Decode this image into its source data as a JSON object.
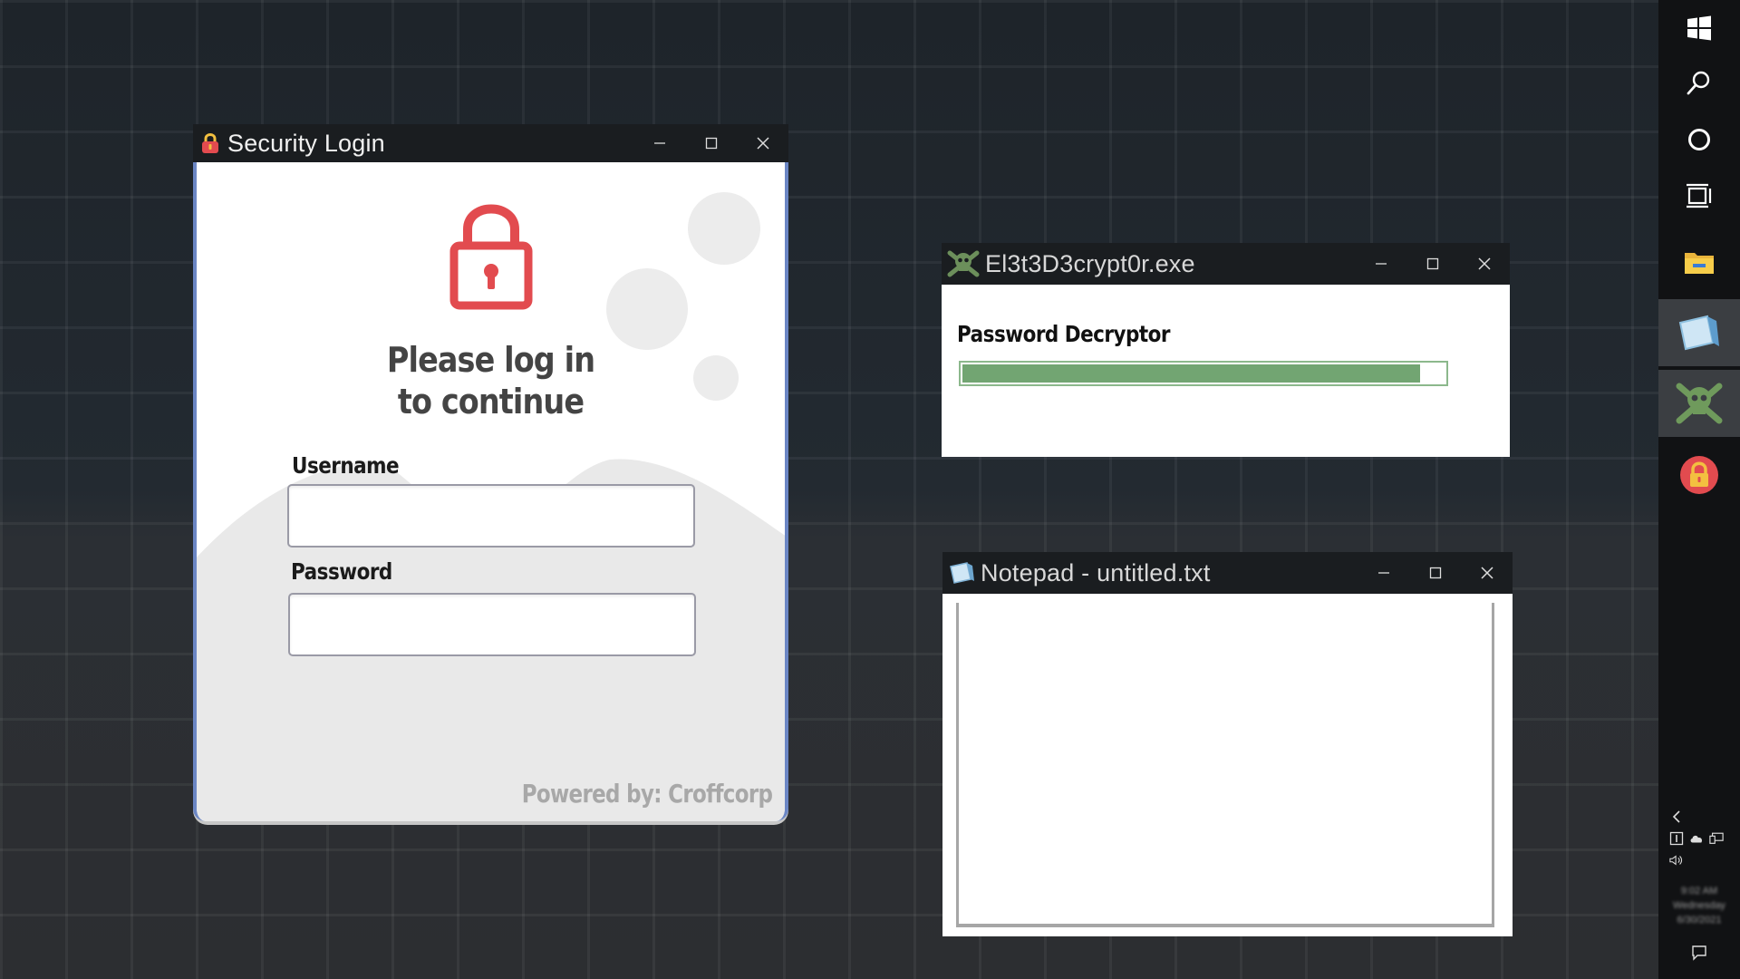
{
  "login_window": {
    "title": "Security Login",
    "heading_line1": "Please log in",
    "heading_line2": "to continue",
    "username_label": "Username",
    "username_value": "",
    "password_label": "Password",
    "password_value": "",
    "footer": "Powered by: Croffcorp",
    "icon": "padlock-icon",
    "accent_color": "#e24b4f"
  },
  "decryptor_window": {
    "title": "El3t3D3crypt0r.exe",
    "heading": "Password Decryptor",
    "progress_percent": 95,
    "progress_color": "#72a572",
    "icon": "skull-crossbones-icon"
  },
  "notepad_window": {
    "title": "Notepad - untitled.txt",
    "content": "",
    "icon": "notepad-icon"
  },
  "taskbar": {
    "items": [
      {
        "name": "start",
        "icon": "windows-logo-icon"
      },
      {
        "name": "search",
        "icon": "search-icon"
      },
      {
        "name": "cortana",
        "icon": "circle-icon"
      },
      {
        "name": "task-view",
        "icon": "task-view-icon"
      },
      {
        "name": "file-explorer",
        "icon": "folder-icon"
      },
      {
        "name": "notepad",
        "icon": "notepad-icon",
        "active": true
      },
      {
        "name": "decryptor",
        "icon": "skull-crossbones-icon",
        "active": true
      },
      {
        "name": "security-login",
        "icon": "padlock-icon"
      }
    ],
    "tray_icons": [
      "chevron-left-icon",
      "ime-icon",
      "onedrive-icon",
      "network-icon",
      "volume-icon"
    ],
    "clock_time": "9:02 AM",
    "clock_day": "Wednesday",
    "clock_date": "6/30/2021"
  }
}
